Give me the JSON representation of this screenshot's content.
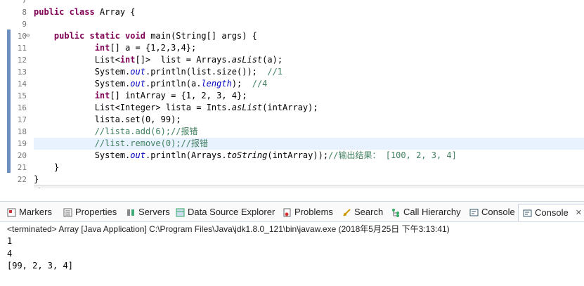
{
  "editor": {
    "lines": [
      {
        "num": "7",
        "segs": []
      },
      {
        "num": "8",
        "segs": [
          {
            "t": "public class ",
            "c": "kw"
          },
          {
            "t": "Array {",
            "c": ""
          }
        ]
      },
      {
        "num": "9",
        "segs": []
      },
      {
        "num": "10",
        "segs": [
          {
            "t": "    ",
            "c": ""
          },
          {
            "t": "public static void ",
            "c": "kw"
          },
          {
            "t": "main(String[] args) {",
            "c": ""
          }
        ]
      },
      {
        "num": "11",
        "segs": [
          {
            "t": "            ",
            "c": ""
          },
          {
            "t": "int",
            "c": "kw"
          },
          {
            "t": "[] a = {1,2,3,4};",
            "c": ""
          }
        ]
      },
      {
        "num": "12",
        "segs": [
          {
            "t": "            List<",
            "c": ""
          },
          {
            "t": "int",
            "c": "kw"
          },
          {
            "t": "[]>  list = Arrays.",
            "c": ""
          },
          {
            "t": "asList",
            "c": "ital"
          },
          {
            "t": "(a);",
            "c": ""
          }
        ]
      },
      {
        "num": "13",
        "segs": [
          {
            "t": "            System.",
            "c": ""
          },
          {
            "t": "out",
            "c": "field"
          },
          {
            "t": ".println(list.size());  ",
            "c": ""
          },
          {
            "t": "//1",
            "c": "cm"
          }
        ]
      },
      {
        "num": "14",
        "segs": [
          {
            "t": "            System.",
            "c": ""
          },
          {
            "t": "out",
            "c": "field"
          },
          {
            "t": ".println(a.",
            "c": ""
          },
          {
            "t": "length",
            "c": "field"
          },
          {
            "t": ");  ",
            "c": ""
          },
          {
            "t": "//4",
            "c": "cm"
          }
        ]
      },
      {
        "num": "15",
        "segs": [
          {
            "t": "            ",
            "c": ""
          },
          {
            "t": "int",
            "c": "kw"
          },
          {
            "t": "[] intArray = {1, 2, 3, 4};",
            "c": ""
          }
        ]
      },
      {
        "num": "16",
        "segs": [
          {
            "t": "            List<Integer> lista = Ints.",
            "c": ""
          },
          {
            "t": "asList",
            "c": "ital"
          },
          {
            "t": "(intArray);",
            "c": ""
          }
        ]
      },
      {
        "num": "17",
        "segs": [
          {
            "t": "            lista.set(0, 99);",
            "c": ""
          }
        ]
      },
      {
        "num": "18",
        "segs": [
          {
            "t": "            ",
            "c": ""
          },
          {
            "t": "//lista.add(6);//报错",
            "c": "cm"
          }
        ]
      },
      {
        "num": "19",
        "segs": [
          {
            "t": "            ",
            "c": ""
          },
          {
            "t": "//list.remove(0);//报错",
            "c": "cm"
          }
        ]
      },
      {
        "num": "20",
        "segs": [
          {
            "t": "            System.",
            "c": ""
          },
          {
            "t": "out",
            "c": "field"
          },
          {
            "t": ".println(Arrays.",
            "c": ""
          },
          {
            "t": "toString",
            "c": "ital"
          },
          {
            "t": "(intArray));",
            "c": ""
          },
          {
            "t": "//输出结果： [100, 2, 3, 4]",
            "c": "cm"
          }
        ]
      },
      {
        "num": "21",
        "segs": [
          {
            "t": "    }",
            "c": ""
          }
        ]
      },
      {
        "num": "22",
        "segs": [
          {
            "t": "}",
            "c": ""
          }
        ]
      }
    ],
    "hscroll_arrow": "<"
  },
  "tabs": {
    "markers": "Markers",
    "properties": "Properties",
    "servers": "Servers",
    "datasource": "Data Source Explorer",
    "problems": "Problems",
    "search": "Search",
    "callhierarchy": "Call Hierarchy",
    "console1": "Console",
    "console2": "Console",
    "close": "✕"
  },
  "console": {
    "status": "<terminated> Array [Java Application] C:\\Program Files\\Java\\jdk1.8.0_121\\bin\\javaw.exe (2018年5月25日 下午3:13:41)",
    "out1": "1",
    "out2": "4",
    "out3": "[99, 2, 3, 4]"
  },
  "colors": {
    "keyword": "#7f0055",
    "comment": "#3f7f5f",
    "field": "#0000c0",
    "marker": "#6d8fc0"
  }
}
